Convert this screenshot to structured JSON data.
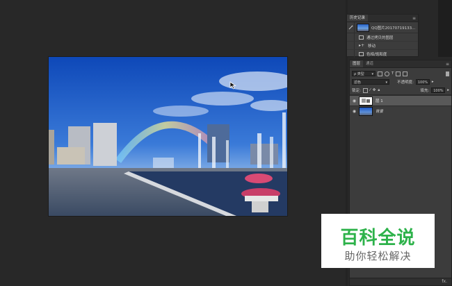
{
  "history_panel": {
    "tabs": [
      "历史记录"
    ],
    "snapshot_label": "QQ图片20170719133...",
    "steps": [
      "通过拷贝的图层",
      "移动",
      "色相/饱和度"
    ]
  },
  "layers_panel": {
    "tabs": [
      "图层",
      "通道"
    ],
    "filter_kind": "类型",
    "blend_mode": "滤色",
    "opacity_label": "不透明度:",
    "opacity_value": "100%",
    "lock_label": "锁定:",
    "fill_label": "填充:",
    "fill_value": "100%",
    "layers": [
      {
        "name": "层 1",
        "selected": true
      },
      {
        "name": "背景",
        "selected": false
      }
    ]
  },
  "footer": {
    "fx": "fx."
  },
  "watermark": {
    "title": "百科全说",
    "subtitle": "助你轻松解决",
    "title_color": "#2db24a"
  }
}
